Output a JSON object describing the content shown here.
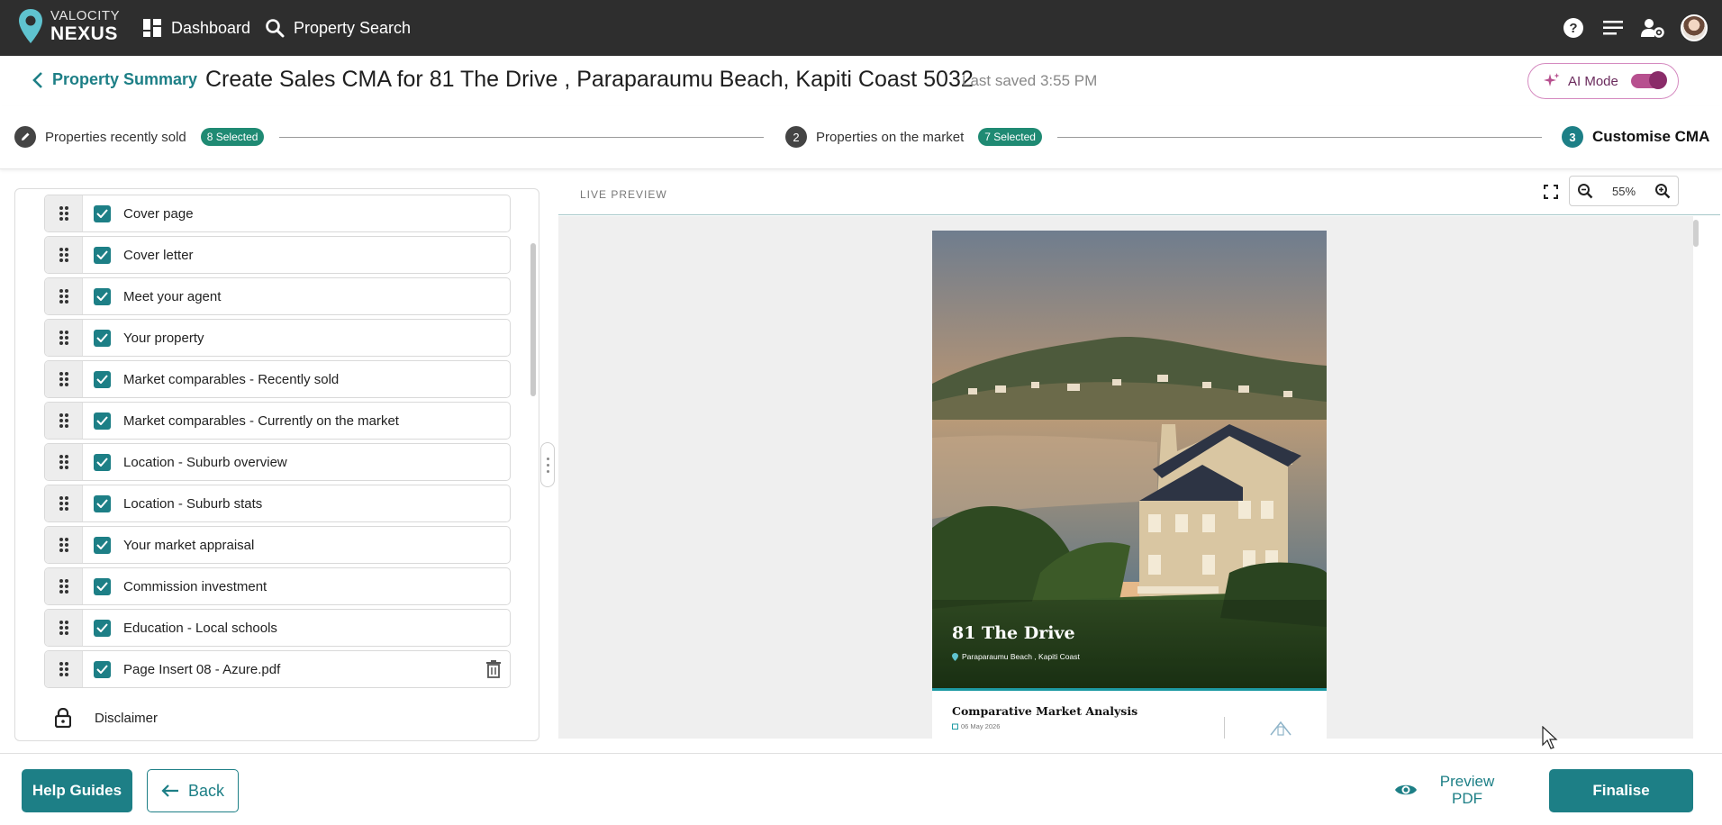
{
  "brand": {
    "line1": "VALOCITY",
    "line2": "NEXUS",
    "accent": "#1d7f86"
  },
  "nav": {
    "dashboard": "Dashboard",
    "property_search": "Property Search",
    "icons": [
      "help-icon",
      "menu-lines-icon",
      "user-settings-icon",
      "avatar"
    ]
  },
  "header": {
    "back_label": "Property Summary",
    "title": "Create Sales CMA for 81 The Drive , Paraparaumu Beach, Kapiti Coast 5032",
    "last_saved": "Last saved 3:55 PM",
    "ai_mode_label": "AI Mode",
    "ai_mode_on": true
  },
  "steps": [
    {
      "number": "",
      "label": "Properties recently sold",
      "badge": "8 Selected",
      "icon": "pencil-icon"
    },
    {
      "number": "2",
      "label": "Properties on the market",
      "badge": "7 Selected"
    },
    {
      "number": "3",
      "label": "Customise CMA",
      "active": true
    }
  ],
  "sections": [
    {
      "label": "Cover page",
      "checked": true
    },
    {
      "label": "Cover letter",
      "checked": true
    },
    {
      "label": "Meet your agent",
      "checked": true
    },
    {
      "label": "Your property",
      "checked": true
    },
    {
      "label": "Market comparables - Recently sold",
      "checked": true
    },
    {
      "label": "Market comparables - Currently on the market",
      "checked": true
    },
    {
      "label": "Location - Suburb overview",
      "checked": true
    },
    {
      "label": "Location - Suburb stats",
      "checked": true
    },
    {
      "label": "Your market appraisal",
      "checked": true
    },
    {
      "label": "Commission investment",
      "checked": true
    },
    {
      "label": "Education - Local schools",
      "checked": true
    },
    {
      "label": "Page Insert 08 - Azure.pdf",
      "checked": true,
      "deletable": true
    }
  ],
  "disclaimer": {
    "label": "Disclaimer",
    "locked": true
  },
  "preview": {
    "label": "LIVE PREVIEW",
    "zoom": "55%",
    "cover_title": "81 The Drive",
    "cover_subtitle": "Paraparaumu Beach , Kapiti Coast",
    "cma_heading": "Comparative Market Analysis",
    "cma_date": "06 May 2026"
  },
  "footer": {
    "help": "Help Guides",
    "back": "Back",
    "preview_line1": "Preview",
    "preview_line2": "PDF",
    "finalise": "Finalise"
  }
}
